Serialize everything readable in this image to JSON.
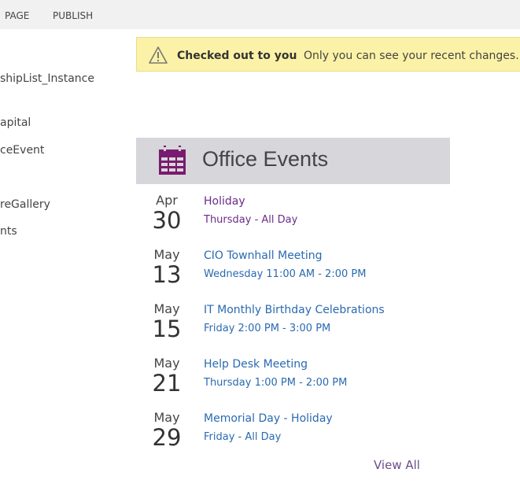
{
  "ribbon": {
    "tabs": [
      "PAGE",
      "PUBLISH"
    ]
  },
  "nav": {
    "items": [
      "shipList_Instance",
      "apital",
      "ceEvent",
      "reGallery",
      "nts"
    ]
  },
  "notice": {
    "title": "Checked out to you",
    "message": "Only you can see your recent changes."
  },
  "webpart": {
    "title": "Office Events",
    "view_all": "View All",
    "events": [
      {
        "month": "Apr",
        "day": "30",
        "title": "Holiday",
        "when": "Thursday - All Day"
      },
      {
        "month": "May",
        "day": "13",
        "title": "CIO Townhall Meeting",
        "when": "Wednesday 11:00 AM - 2:00 PM"
      },
      {
        "month": "May",
        "day": "15",
        "title": "IT Monthly Birthday Celebrations",
        "when": "Friday 2:00 PM - 3:00 PM"
      },
      {
        "month": "May",
        "day": "21",
        "title": "Help Desk Meeting",
        "when": "Thursday 1:00 PM - 2:00 PM"
      },
      {
        "month": "May",
        "day": "29",
        "title": "Memorial Day - Holiday",
        "when": "Friday - All Day"
      }
    ]
  },
  "colors": {
    "accent": "#7a1a6e",
    "link": "#2a6ab0",
    "visited": "#6b2c8a",
    "notice": "#fcf2a7"
  }
}
